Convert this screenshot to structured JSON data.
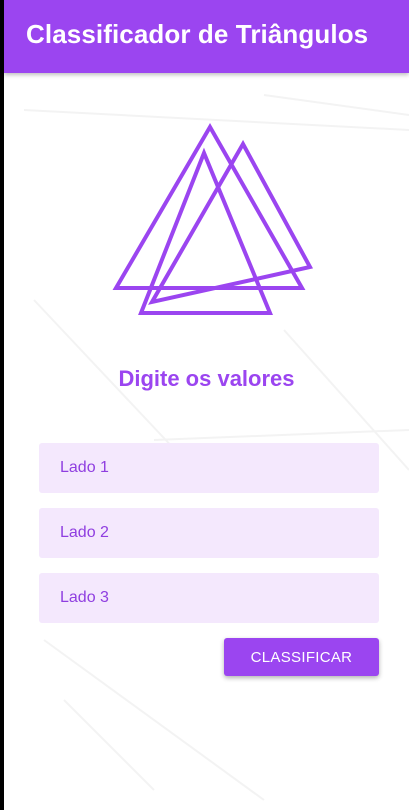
{
  "app": {
    "title": "Classificador de Triângulos"
  },
  "logo": {
    "icon": "overlapping-triangles-icon"
  },
  "main": {
    "subtitle": "Digite os valores"
  },
  "form": {
    "fields": [
      {
        "placeholder": "Lado 1",
        "value": ""
      },
      {
        "placeholder": "Lado 2",
        "value": ""
      },
      {
        "placeholder": "Lado 3",
        "value": ""
      }
    ],
    "submit_label": "CLASSIFICAR"
  },
  "colors": {
    "accent": "#9b45f0",
    "field_background": "#f4e8fd",
    "background": "#ffffff"
  }
}
